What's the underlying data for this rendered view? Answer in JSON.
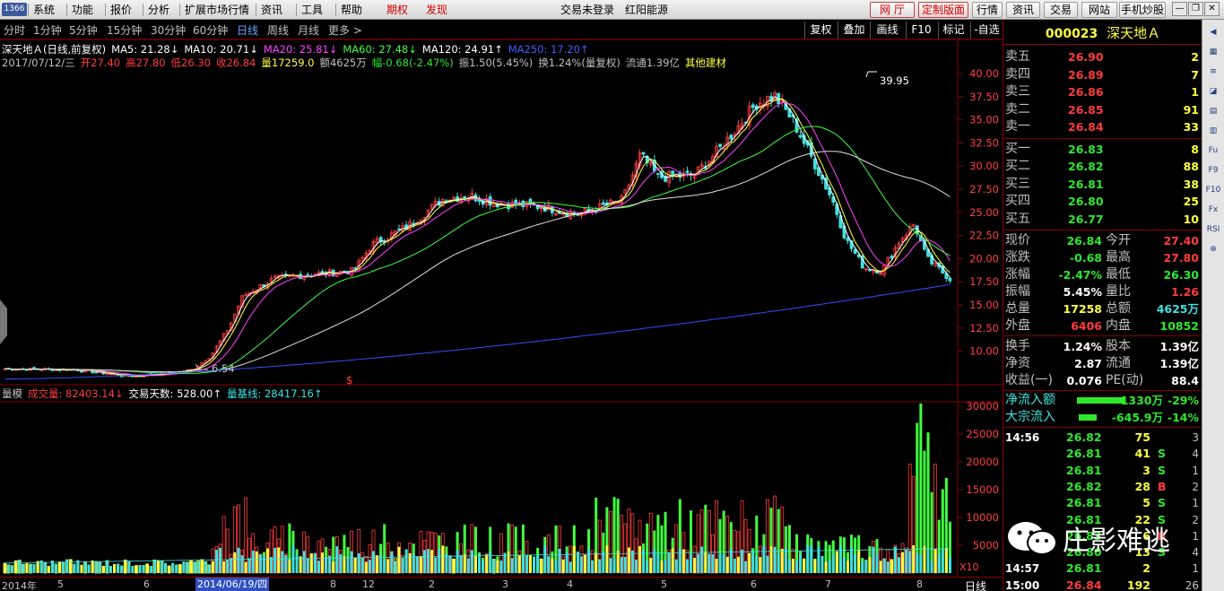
{
  "topbar": {
    "logo": "1366",
    "menus": [
      "系统",
      "功能",
      "报价",
      "分析",
      "扩展市场行情",
      "资讯",
      "工具",
      "帮助"
    ],
    "red_menus": [
      "期权",
      "发现"
    ],
    "center_text": "交易未登录",
    "center_stock": "红阳能源",
    "right_buttons": [
      "网 厅",
      "定制版面",
      "行情",
      "资讯",
      "交易",
      "网站",
      "手机炒股"
    ]
  },
  "periods": [
    "分时",
    "1分钟",
    "5分钟",
    "15分钟",
    "30分钟",
    "60分钟",
    "日线",
    "周线",
    "月线",
    "更多 >"
  ],
  "active_period": "日线",
  "chart_tools": [
    "复权",
    "叠加",
    "画线",
    "F10",
    "标记",
    "-自选"
  ],
  "info": {
    "line1": [
      {
        "t": "深天地Ａ(日线,前复权)",
        "c": "#ffffff"
      },
      {
        "t": "MA5: 21.28↓",
        "c": "#ffffff"
      },
      {
        "t": "MA10: 20.71↓",
        "c": "#ffffff"
      },
      {
        "t": "MA20: 25.81↓",
        "c": "#ff40ff"
      },
      {
        "t": "MA60: 27.48↓",
        "c": "#40ff40"
      },
      {
        "t": "MA120: 24.91↑",
        "c": "#ffffff"
      },
      {
        "t": "MA250: 17.20↑",
        "c": "#4060ff"
      }
    ],
    "line2": [
      {
        "t": "2017/07/12/三",
        "c": "#c0c0c0"
      },
      {
        "t": "开27.40",
        "c": "#ff3c3c"
      },
      {
        "t": "高27.80",
        "c": "#ff3c3c"
      },
      {
        "t": "低26.30",
        "c": "#ff3c3c"
      },
      {
        "t": "收26.84",
        "c": "#ff3c3c"
      },
      {
        "t": "量17259.0",
        "c": "#ffff40"
      },
      {
        "t": "额4625万",
        "c": "#c0c0c0"
      },
      {
        "t": "幅-0.68(-2.47%)",
        "c": "#2ee82e"
      },
      {
        "t": "振1.50(5.45%)",
        "c": "#c0c0c0"
      },
      {
        "t": "换1.24%(量复权)",
        "c": "#c0c0c0"
      },
      {
        "t": "流通1.39亿",
        "c": "#c0c0c0"
      },
      {
        "t": "其他建材",
        "c": "#ffff40"
      }
    ]
  },
  "price_axis": [
    "40.00",
    "37.50",
    "35.00",
    "32.50",
    "30.00",
    "27.50",
    "25.00",
    "22.50",
    "20.00",
    "17.50",
    "15.00",
    "12.50",
    "10.00"
  ],
  "price_high_label": "39.95",
  "price_low_label": "6.54",
  "volume_axis": [
    "30000",
    "25000",
    "20000",
    "15000",
    "10000",
    "5000"
  ],
  "volume_unit": "X10",
  "volinfo": [
    {
      "t": "量模",
      "c": "#c0c0c0"
    },
    {
      "t": "成交量: 82403.14↓",
      "c": "#ff3c3c"
    },
    {
      "t": "交易天数: 528.00↑",
      "c": "#ffffff"
    },
    {
      "t": "量基线: 28417.16↑",
      "c": "#40e0e0"
    }
  ],
  "dates": [
    "2014年",
    "5",
    "6",
    "2014/06/19/四",
    "8",
    "12",
    "2",
    "3",
    "4",
    "5",
    "6",
    "7",
    "8"
  ],
  "date_tab": "日线",
  "stock": {
    "code": "000023",
    "name": "深天地Ａ"
  },
  "orderbook": {
    "asks": [
      {
        "label": "卖五",
        "price": "26.90",
        "vol": "2"
      },
      {
        "label": "卖四",
        "price": "26.89",
        "vol": "7"
      },
      {
        "label": "卖三",
        "price": "26.86",
        "vol": "1"
      },
      {
        "label": "卖二",
        "price": "26.85",
        "vol": "91"
      },
      {
        "label": "卖一",
        "price": "26.84",
        "vol": "33"
      }
    ],
    "bids": [
      {
        "label": "买一",
        "price": "26.83",
        "vol": "8"
      },
      {
        "label": "买二",
        "price": "26.82",
        "vol": "88"
      },
      {
        "label": "买三",
        "price": "26.81",
        "vol": "38"
      },
      {
        "label": "买四",
        "price": "26.80",
        "vol": "25"
      },
      {
        "label": "买五",
        "price": "26.77",
        "vol": "10"
      }
    ]
  },
  "quote": [
    {
      "l1": "现价",
      "v1": "26.84",
      "c1": "grn",
      "l2": "今开",
      "v2": "27.40",
      "c2": "red"
    },
    {
      "l1": "涨跌",
      "v1": "-0.68",
      "c1": "grn",
      "l2": "最高",
      "v2": "27.80",
      "c2": "red"
    },
    {
      "l1": "涨幅",
      "v1": "-2.47%",
      "c1": "grn",
      "l2": "最低",
      "v2": "26.30",
      "c2": "grn"
    },
    {
      "l1": "振幅",
      "v1": "5.45%",
      "c1": "wht",
      "l2": "量比",
      "v2": "1.26",
      "c2": "red"
    },
    {
      "l1": "总量",
      "v1": "17258",
      "c1": "yel",
      "l2": "总额",
      "v2": "4625万",
      "c2": "cya"
    },
    {
      "l1": "外盘",
      "v1": "6406",
      "c1": "red",
      "l2": "内盘",
      "v2": "10852",
      "c2": "grn"
    }
  ],
  "fundamentals": [
    {
      "l1": "换手",
      "v1": "1.24%",
      "l2": "股本",
      "v2": "1.39亿"
    },
    {
      "l1": "净资",
      "v1": "2.87",
      "l2": "流通",
      "v2": "1.39亿"
    },
    {
      "l1": "收益(一)",
      "v1": "0.076",
      "l2": "PE(动)",
      "v2": "88.4"
    }
  ],
  "flows": [
    {
      "label": "净流入额",
      "value": "-1330万",
      "pct": "-29%"
    },
    {
      "label": "大宗流入",
      "value": "-645.9万",
      "pct": "-14%"
    }
  ],
  "ticks": [
    {
      "time": "14:56",
      "price": "26.82",
      "vol": "75",
      "side": "",
      "n": "3"
    },
    {
      "time": "",
      "price": "26.81",
      "vol": "41",
      "side": "S",
      "n": "4"
    },
    {
      "time": "",
      "price": "26.81",
      "vol": "3",
      "side": "S",
      "n": "1"
    },
    {
      "time": "",
      "price": "26.82",
      "vol": "28",
      "side": "B",
      "n": "2"
    },
    {
      "time": "",
      "price": "26.81",
      "vol": "5",
      "side": "S",
      "n": "1"
    },
    {
      "time": "",
      "price": "26.81",
      "vol": "22",
      "side": "S",
      "n": "2"
    },
    {
      "time": "",
      "price": "26.83",
      "vol": "6",
      "side": "B",
      "n": "1"
    },
    {
      "time": "",
      "price": "26.80",
      "vol": "13",
      "side": "S",
      "n": "4"
    },
    {
      "time": "14:57",
      "price": "26.81",
      "vol": "2",
      "side": "",
      "n": "1"
    },
    {
      "time": "15:00",
      "price": "26.84",
      "vol": "192",
      "side": "",
      "n": "26"
    }
  ],
  "watermark": "庄影难逃",
  "toolstrip": [
    "◀",
    "▦",
    "≡",
    "◪",
    "▤",
    "▥",
    "Fu",
    "F9",
    "F10",
    "Fx",
    "RSI",
    "⊕"
  ]
}
